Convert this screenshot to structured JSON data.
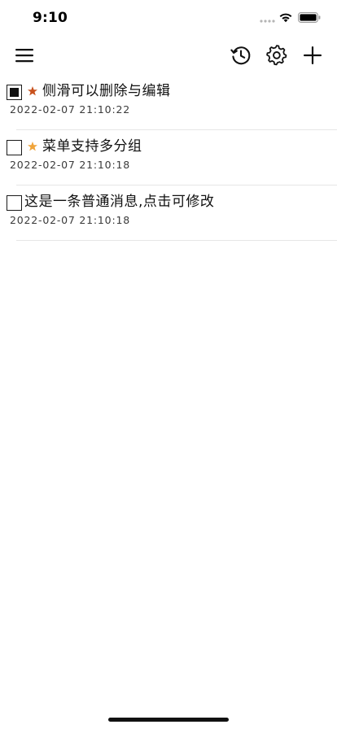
{
  "status_bar": {
    "time": "9:10"
  },
  "nav": {
    "menu_icon": "hamburger-menu-icon",
    "history_icon": "history-clock-icon",
    "settings_icon": "gear-icon",
    "add_icon": "plus-icon"
  },
  "colors": {
    "star_primary": "#c8521e",
    "star_secondary": "#f0a43a",
    "checkbox_border": "#1a1a1a",
    "divider": "#e6e6e6"
  },
  "messages": [
    {
      "title": "侧滑可以删除与编辑",
      "time": "2022-02-07 21:10:22",
      "checked": true,
      "starred": true,
      "star_color": "#c8521e"
    },
    {
      "title": "菜单支持多分组",
      "time": "2022-02-07 21:10:18",
      "checked": false,
      "starred": true,
      "star_color": "#f0a43a"
    },
    {
      "title": "这是一条普通消息,点击可修改",
      "time": "2022-02-07 21:10:18",
      "checked": false,
      "starred": false
    }
  ]
}
